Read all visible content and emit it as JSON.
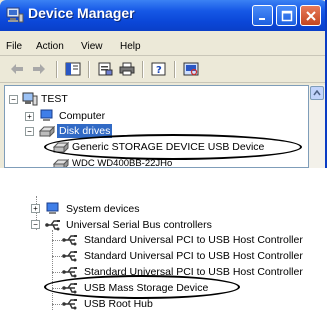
{
  "window": {
    "title": "Device Manager"
  },
  "menu": [
    "File",
    "Action",
    "View",
    "Help"
  ],
  "toolbar": {
    "buttons": [
      "back-icon",
      "forward-icon",
      "console-tree-icon",
      "properties-icon",
      "print-icon",
      "help-icon",
      "scan-hardware-icon"
    ]
  },
  "tree_top": {
    "root": "TEST",
    "computer": "Computer",
    "disk_drives": "Disk drives",
    "generic_storage": "Generic STORAGE DEVICE USB Device",
    "wdc": "WDC WD400BB-22JHo"
  },
  "tree_bottom": {
    "system_devices": "System devices",
    "usb_controllers": "Universal Serial Bus controllers",
    "host1": "Standard Universal PCI to USB Host Controller",
    "host2": "Standard Universal PCI to USB Host Controller",
    "host3": "Standard Universal PCI to USB Host Controller",
    "mass_storage": "USB Mass Storage Device",
    "root_hub": "USB Root Hub"
  },
  "colors": {
    "titlebar": "#0b47d8",
    "selection": "#316ac5",
    "chrome": "#ece9d8"
  }
}
